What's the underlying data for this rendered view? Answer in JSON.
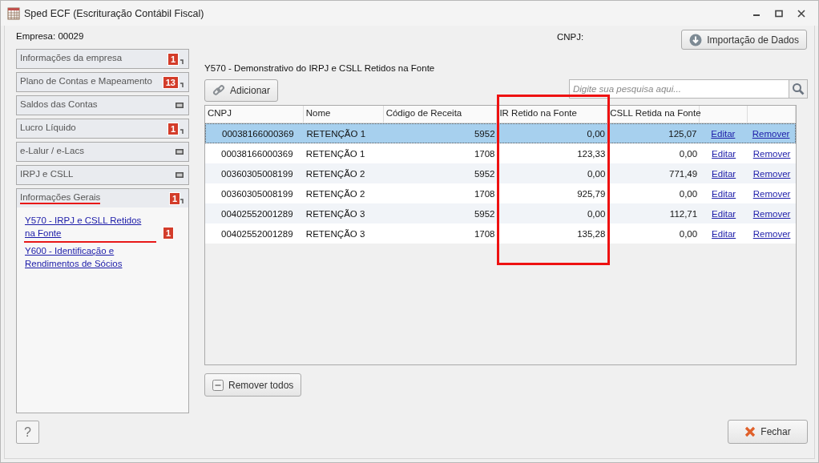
{
  "window": {
    "title": "Sped ECF (Escrituração Contábil Fiscal)"
  },
  "header": {
    "empresa": "Empresa: 00029",
    "cnpj": "CNPJ:",
    "import_button": "Importação de Dados"
  },
  "sidebar": {
    "items": [
      {
        "label": "Informações da empresa",
        "badge": "1",
        "expanded": false,
        "underlined": false
      },
      {
        "label": "Plano de Contas e Mapeamento",
        "badge": "13",
        "expanded": false,
        "underlined": false
      },
      {
        "label": "Saldos das Contas",
        "expanded": false,
        "underlined": false
      },
      {
        "label": "Lucro Líquido",
        "badge": "1",
        "expanded": false,
        "underlined": false
      },
      {
        "label": "e-Lalur / e-Lacs",
        "expanded": false,
        "underlined": false
      },
      {
        "label": "IRPJ e CSLL",
        "expanded": false,
        "underlined": false
      },
      {
        "label": "Informações Gerais",
        "badge": "1",
        "expanded": true,
        "underlined": true,
        "children": [
          {
            "label": "Y570 - IRPJ e CSLL Retidos na Fonte",
            "badge": "1",
            "underlined": true
          },
          {
            "label": "Y600 - Identificação e Rendimentos de Sócios",
            "underlined": false
          }
        ]
      }
    ]
  },
  "help_button": "?",
  "main": {
    "title": "Y570 - Demonstrativo do IRPJ e CSLL Retidos na Fonte",
    "add_button": "Adicionar",
    "search": {
      "placeholder": "Digite sua pesquisa aqui..."
    },
    "table": {
      "columns": [
        {
          "label": "CNPJ",
          "highlighted": false
        },
        {
          "label": "Nome",
          "highlighted": false
        },
        {
          "label": "Código de Receita",
          "highlighted": false
        },
        {
          "label": "IR Retido na Fonte",
          "highlighted": true
        },
        {
          "label": "CSLL Retida na Fonte",
          "highlighted": false
        }
      ],
      "rows": [
        {
          "cnpj": "00038166000369",
          "nome": "RETENÇÃO 1",
          "codigo": "5952",
          "ir": "0,00",
          "csll": "125,07",
          "edit": "Editar",
          "remove": "Remover",
          "selected": true
        },
        {
          "cnpj": "00038166000369",
          "nome": "RETENÇÃO 1",
          "codigo": "1708",
          "ir": "123,33",
          "csll": "0,00",
          "edit": "Editar",
          "remove": "Remover",
          "selected": false
        },
        {
          "cnpj": "00360305008199",
          "nome": "RETENÇÃO 2",
          "codigo": "5952",
          "ir": "0,00",
          "csll": "771,49",
          "edit": "Editar",
          "remove": "Remover",
          "selected": false
        },
        {
          "cnpj": "00360305008199",
          "nome": "RETENÇÃO 2",
          "codigo": "1708",
          "ir": "925,79",
          "csll": "0,00",
          "edit": "Editar",
          "remove": "Remover",
          "selected": false
        },
        {
          "cnpj": "00402552001289",
          "nome": "RETENÇÃO 3",
          "codigo": "5952",
          "ir": "0,00",
          "csll": "112,71",
          "edit": "Editar",
          "remove": "Remover",
          "selected": false
        },
        {
          "cnpj": "00402552001289",
          "nome": "RETENÇÃO 3",
          "codigo": "1708",
          "ir": "135,28",
          "csll": "0,00",
          "edit": "Editar",
          "remove": "Remover",
          "selected": false
        }
      ]
    },
    "remove_all_button": "Remover todos",
    "close_button": "Fechar"
  }
}
